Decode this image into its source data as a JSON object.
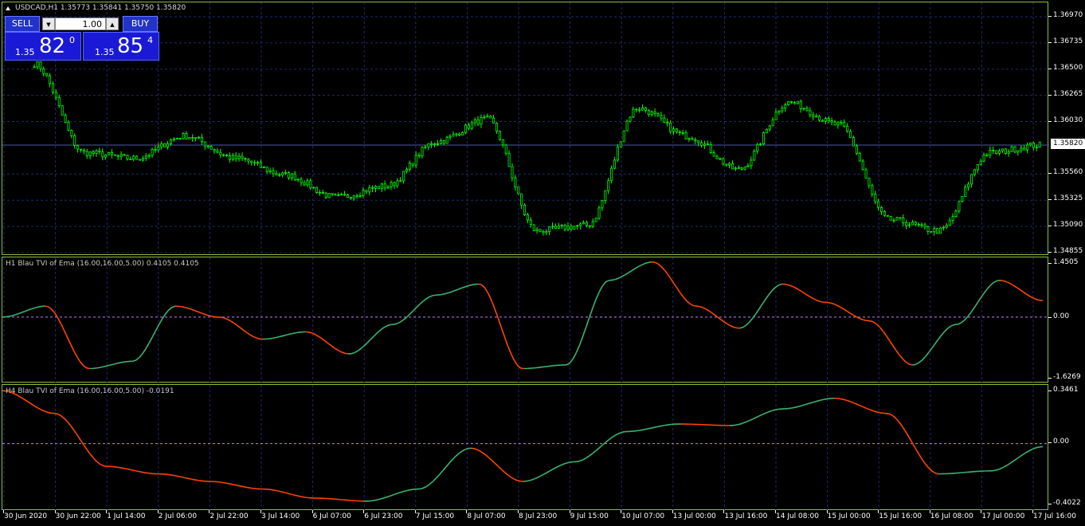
{
  "header": {
    "title": "USDCAD,H1  1.35773 1.35841 1.35750 1.35820"
  },
  "trade_panel": {
    "sell_label": "SELL",
    "buy_label": "BUY",
    "lot": "1.00",
    "sell_prefix": "1.35",
    "sell_big": "82",
    "sell_sup": "0",
    "buy_prefix": "1.35",
    "buy_big": "85",
    "buy_sup": "4"
  },
  "price_axis": [
    "1.36970",
    "1.36735",
    "1.36500",
    "1.36265",
    "1.36030",
    "1.35820",
    "1.35560",
    "1.35325",
    "1.35090",
    "1.34855"
  ],
  "current_price": "1.35820",
  "ind1": {
    "title": "H1 Blau TVI of Ema (16.00,16.00,5.00) 0.4105 0.4105",
    "axis": [
      "1.4505",
      "0.00",
      "-1.6269"
    ]
  },
  "ind2": {
    "title": "H4 Blau TVI of Ema (16.00,16.00,5.00) -0.0191",
    "axis": [
      "0.3461",
      "0.00",
      "-0.4022"
    ]
  },
  "time_axis": [
    "30 Jun 2020",
    "30 Jun 22:00",
    "1 Jul 14:00",
    "2 Jul 06:00",
    "2 Jul 22:00",
    "3 Jul 14:00",
    "6 Jul 07:00",
    "6 Jul 23:00",
    "7 Jul 15:00",
    "8 Jul 07:00",
    "8 Jul 23:00",
    "9 Jul 15:00",
    "10 Jul 07:00",
    "13 Jul 00:00",
    "13 Jul 16:00",
    "14 Jul 08:00",
    "15 Jul 00:00",
    "15 Jul 16:00",
    "16 Jul 08:00",
    "17 Jul 00:00",
    "17 Jul 16:00"
  ],
  "colors": {
    "candle": "#00ff00",
    "up_line": "#3cb371",
    "down_line": "#ff4500",
    "grid": "#1e2a6e",
    "frame": "#8fbf3a",
    "zero_line": "#c080ff",
    "trade_button": "#2233cc"
  },
  "chart_data": {
    "type": "line",
    "title": "USDCAD,H1",
    "series": [
      {
        "name": "USDCAD,H1",
        "x_labels": [
          "30 Jun 2020",
          "30 Jun 22:00",
          "1 Jul 14:00",
          "2 Jul 06:00",
          "2 Jul 22:00",
          "3 Jul 14:00",
          "6 Jul 07:00",
          "6 Jul 23:00",
          "7 Jul 15:00",
          "8 Jul 07:00",
          "8 Jul 23:00",
          "9 Jul 15:00",
          "10 Jul 07:00",
          "13 Jul 00:00",
          "13 Jul 16:00",
          "14 Jul 08:00",
          "15 Jul 00:00",
          "15 Jul 16:00",
          "16 Jul 08:00",
          "17 Jul 00:00",
          "17 Jul 16:00"
        ],
        "values": [
          1.3655,
          1.3575,
          1.357,
          1.359,
          1.357,
          1.3555,
          1.3535,
          1.3545,
          1.3585,
          1.3605,
          1.3505,
          1.351,
          1.3615,
          1.359,
          1.356,
          1.362,
          1.36,
          1.3515,
          1.3505,
          1.3575,
          1.3582
        ]
      },
      {
        "name": "H1 Blau TVI of Ema (16.00,16.00,5.00)",
        "values": [
          0.0,
          0.3,
          -1.4,
          -1.2,
          0.3,
          0.0,
          -0.6,
          -0.4,
          -1.0,
          -0.2,
          0.6,
          0.9,
          -1.4,
          -1.3,
          1.0,
          1.5,
          0.3,
          -0.3,
          0.9,
          0.4,
          -0.1,
          -1.3,
          -0.2,
          1.0,
          0.45
        ]
      },
      {
        "name": "H4 Blau TVI of Ema (16.00,16.00,5.00)",
        "values": [
          0.35,
          0.2,
          -0.15,
          -0.2,
          -0.25,
          -0.3,
          -0.36,
          -0.38,
          -0.3,
          -0.03,
          -0.25,
          -0.12,
          0.08,
          0.13,
          0.12,
          0.23,
          0.3,
          0.2,
          -0.2,
          -0.18,
          -0.02
        ]
      }
    ],
    "ylim_price": [
      1.34855,
      1.3697
    ],
    "ylim_ind1": [
      -1.6269,
      1.4505
    ],
    "ylim_ind2": [
      -0.4022,
      0.3461
    ],
    "grid": true
  }
}
